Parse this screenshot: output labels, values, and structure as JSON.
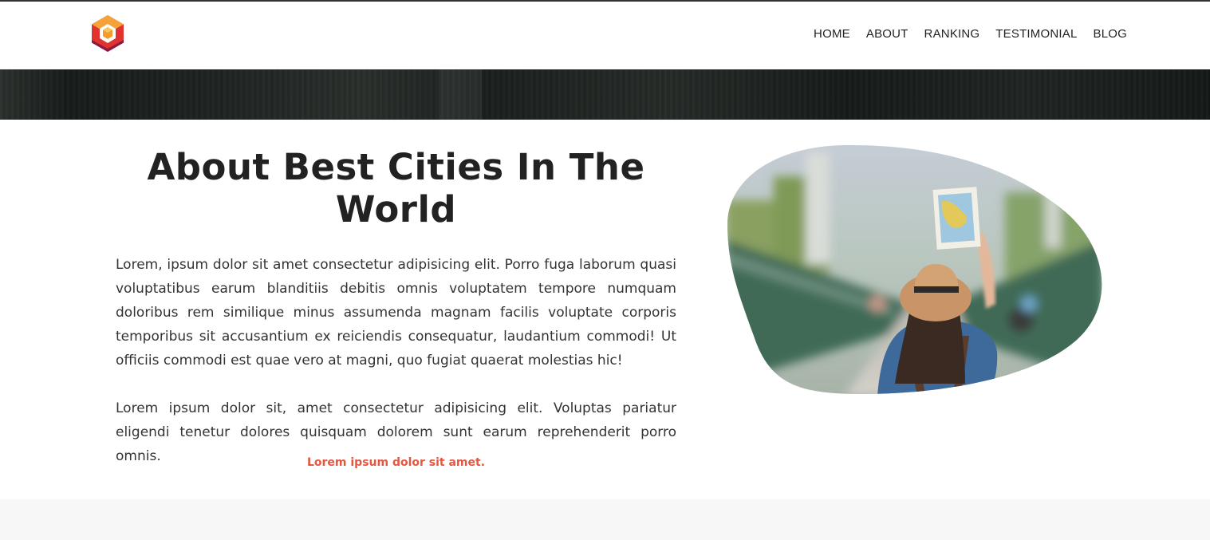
{
  "nav": {
    "logo_name": "hexagon-cube-logo",
    "items": [
      {
        "label": "HOME"
      },
      {
        "label": "ABOUT"
      },
      {
        "label": "RANKING"
      },
      {
        "label": "TESTIMONIAL"
      },
      {
        "label": "BLOG"
      }
    ]
  },
  "about": {
    "title": "About Best Cities In The World",
    "paragraphs": [
      "Lorem, ipsum dolor sit amet consectetur adipisicing elit. Porro fuga laborum quasi voluptatibus earum blanditiis debitis omnis voluptatem tempore numquam doloribus rem similique minus assumenda magnam facilis voluptate corporis temporibus sit accusantium ex reiciendis consequatur, laudantium commodi! Ut officiis commodi est quae vero at magni, quo fugiat quaerat molestias hic!",
      "Lorem ipsum dolor sit, amet consectetur adipisicing elit. Voluptas pariatur eligendi tenetur dolores quisquam dolorem sunt earum reprehenderit porro omnis."
    ],
    "highlight": "Lorem ipsum dolor sit amet.",
    "image_subject": "traveler-with-map-on-bridge"
  },
  "colors": {
    "accent": "#e8563f",
    "logo_orange": "#f39c2a",
    "logo_red": "#e0322f",
    "logo_crimson": "#8e1b3e",
    "bottom_band": "#f7f7f7"
  }
}
